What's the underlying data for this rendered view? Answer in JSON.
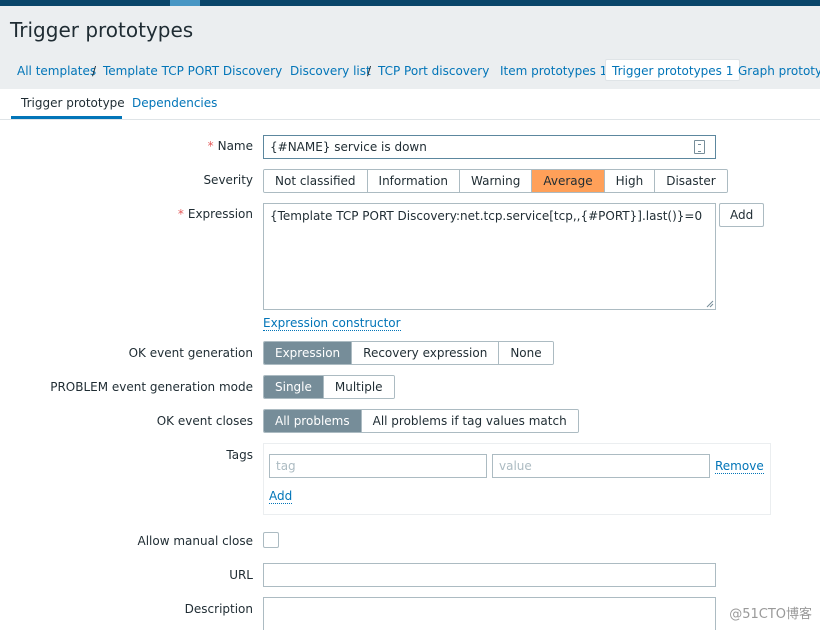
{
  "page": {
    "title": "Trigger prototypes"
  },
  "breadcrumb": {
    "all_templates": "All templates",
    "template": "Template TCP PORT Discovery",
    "discovery_list": "Discovery list",
    "discovery_rule": "TCP Port discovery",
    "item_prototypes": "Item prototypes 1",
    "trigger_prototypes": "Trigger prototypes 1",
    "graph_prototypes": "Graph prototypes",
    "separator": "/"
  },
  "tabs": {
    "trigger_prototype": "Trigger prototype",
    "dependencies": "Dependencies"
  },
  "form": {
    "name": {
      "label": "Name",
      "value": "{#NAME} service is down"
    },
    "severity": {
      "label": "Severity",
      "options": [
        "Not classified",
        "Information",
        "Warning",
        "Average",
        "High",
        "Disaster"
      ],
      "selected": "Average"
    },
    "expression": {
      "label": "Expression",
      "value": "{Template TCP PORT Discovery:net.tcp.service[tcp,,{#PORT}].last()}=0",
      "add_label": "Add",
      "constructor_link": "Expression constructor"
    },
    "ok_event_generation": {
      "label": "OK event generation",
      "options": [
        "Expression",
        "Recovery expression",
        "None"
      ],
      "selected": "Expression"
    },
    "problem_mode": {
      "label": "PROBLEM event generation mode",
      "options": [
        "Single",
        "Multiple"
      ],
      "selected": "Single"
    },
    "ok_event_closes": {
      "label": "OK event closes",
      "options": [
        "All problems",
        "All problems if tag values match"
      ],
      "selected": "All problems"
    },
    "tags": {
      "label": "Tags",
      "tag_placeholder": "tag",
      "value_placeholder": "value",
      "remove_label": "Remove",
      "add_label": "Add"
    },
    "allow_manual_close": {
      "label": "Allow manual close",
      "checked": false
    },
    "url": {
      "label": "URL",
      "value": ""
    },
    "description": {
      "label": "Description",
      "value": ""
    }
  },
  "watermark": "@51CTO博客",
  "colors": {
    "accent": "#0275b8",
    "severity_average": "#ffa059",
    "toggle_selected": "#768d99",
    "topbar": "#0a466a"
  }
}
